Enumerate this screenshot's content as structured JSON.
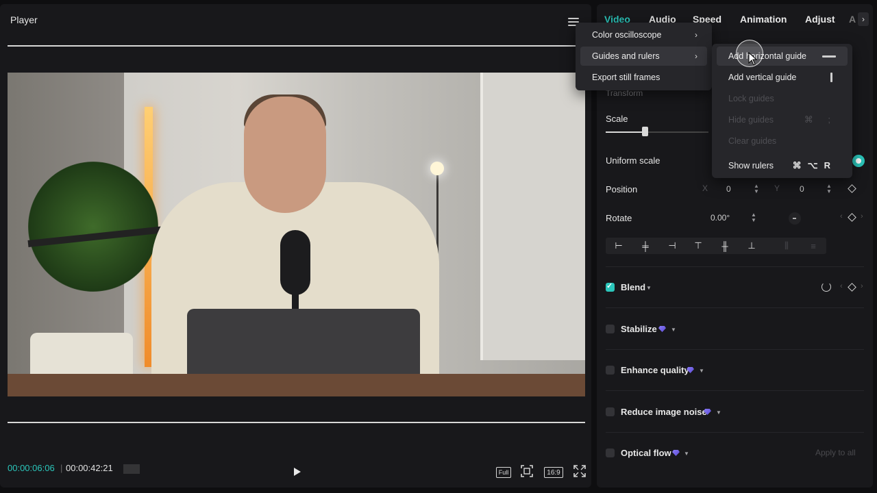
{
  "player": {
    "title": "Player",
    "timecode_current": "00:00:06:06",
    "timecode_total": "00:00:42:21",
    "full_label": "Full",
    "ratio_label": "16:9"
  },
  "inspector": {
    "tabs": [
      "Video",
      "Audio",
      "Speed",
      "Animation",
      "Adjust",
      "A"
    ],
    "active_tab": "Video",
    "transform_label": "Transform",
    "scale_label": "Scale",
    "scale_value_fraction": 0.38,
    "uniform_scale_label": "Uniform scale",
    "position_label": "Position",
    "position_x_label": "X",
    "position_x": "0",
    "position_y_label": "Y",
    "position_y": "0",
    "rotate_label": "Rotate",
    "rotate_value": "0.00°",
    "features": [
      {
        "label": "Blend",
        "checked": true,
        "premium": false
      },
      {
        "label": "Stabilize",
        "checked": false,
        "premium": true
      },
      {
        "label": "Enhance quality",
        "checked": false,
        "premium": true
      },
      {
        "label": "Reduce image noise",
        "checked": false,
        "premium": true
      },
      {
        "label": "Optical flow",
        "checked": false,
        "premium": true
      }
    ],
    "apply_all": "Apply to all",
    "accent_color": "#2bc6bb"
  },
  "menu_main": {
    "items": [
      {
        "label": "Color oscilloscope"
      },
      {
        "label": "Guides and rulers"
      },
      {
        "label": "Export still frames"
      }
    ]
  },
  "menu_sub": {
    "items": [
      {
        "label": "Add horizontal guide",
        "enabled": true
      },
      {
        "label": "Add vertical guide",
        "enabled": true
      },
      {
        "label": "Lock guides",
        "enabled": false
      },
      {
        "label": "Hide guides",
        "enabled": false,
        "shortcut": "⌘ ;"
      },
      {
        "label": "Clear guides",
        "enabled": false
      },
      {
        "label": "Show rulers",
        "enabled": true,
        "shortcut": "⌘⌥R"
      }
    ]
  }
}
